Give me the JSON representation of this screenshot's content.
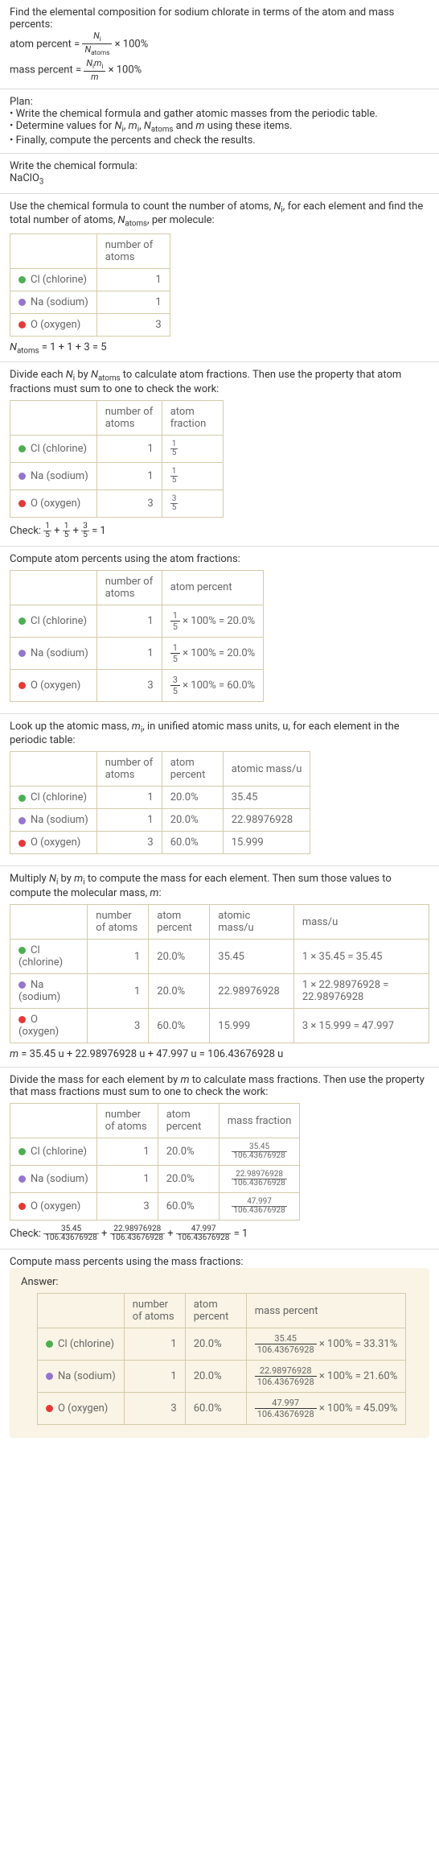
{
  "intro": {
    "line1": "Find the elemental composition for sodium chlorate in terms of the atom and mass percents:",
    "atom_percent_lhs": "atom percent = ",
    "atom_percent_rhs": " × 100%",
    "mass_percent_lhs": "mass percent = ",
    "mass_percent_rhs": " × 100%",
    "frac_ni": "N",
    "frac_ni_sub": "i",
    "frac_natoms": "N",
    "frac_natoms_sub": "atoms",
    "frac_nimi": "N",
    "frac_nimi2_sub": "i",
    "frac_m": "m",
    "frac_m_sub": "i",
    "frac_m_den": "m"
  },
  "plan": {
    "title": "Plan:",
    "b1": "• Write the chemical formula and gather atomic masses from the periodic table.",
    "b2_a": "• Determine values for ",
    "b2_b": " using these items.",
    "var_ni": "N",
    "var_ni_s": "i",
    "var_mi": "m",
    "var_mi_s": "i",
    "var_na": "N",
    "var_na_s": "atoms",
    "var_m": "m",
    "and": " and ",
    "b3": "• Finally, compute the percents and check the results."
  },
  "formula_section": {
    "title": "Write the chemical formula:",
    "formula": "NaClO",
    "formula_sub": "3"
  },
  "count_atoms": {
    "title_a": "Use the chemical formula to count the number of atoms, ",
    "title_ni": "N",
    "title_ni_s": "i",
    "title_b": ", for each element and find the total number of atoms, ",
    "title_na": "N",
    "title_na_s": "atoms",
    "title_c": ", per molecule:",
    "hdr_blank": "",
    "hdr_num": "number of atoms",
    "cl_label": "Cl (chlorine)",
    "cl_n": "1",
    "na_label": "Na (sodium)",
    "na_n": "1",
    "o_label": "O (oxygen)",
    "o_n": "3",
    "total_a": "N",
    "total_a_s": "atoms",
    "total_eq": " = 1 + 1 + 3 = 5"
  },
  "atom_fractions": {
    "title_a": "Divide each ",
    "ni": "N",
    "ni_s": "i",
    "title_b": " by ",
    "na": "N",
    "na_s": "atoms",
    "title_c": " to calculate atom fractions. Then use the property that atom fractions must sum to one to check the work:",
    "hdr_num": "number of atoms",
    "hdr_frac": "atom fraction",
    "cl_label": "Cl (chlorine)",
    "cl_n": "1",
    "cl_fn": "1",
    "cl_fd": "5",
    "na_label": "Na (sodium)",
    "na_n": "1",
    "na_fn": "1",
    "na_fd": "5",
    "o_label": "O (oxygen)",
    "o_n": "3",
    "o_fn": "3",
    "o_fd": "5",
    "check": "Check: ",
    "eq": " = 1"
  },
  "atom_percents": {
    "title": "Compute atom percents using the atom fractions:",
    "hdr_num": "number of atoms",
    "hdr_pct": "atom percent",
    "cl_label": "Cl (chlorine)",
    "cl_n": "1",
    "cl_tail": " × 100% = 20.0%",
    "na_label": "Na (sodium)",
    "na_n": "1",
    "na_tail": " × 100% = 20.0%",
    "o_label": "O (oxygen)",
    "o_n": "3",
    "o_tail": " × 100% = 60.0%"
  },
  "atomic_mass": {
    "title_a": "Look up the atomic mass, ",
    "mi": "m",
    "mi_s": "i",
    "title_b": ", in unified atomic mass units, u, for each element in the periodic table:",
    "hdr_num": "number of atoms",
    "hdr_pct": "atom percent",
    "hdr_mass": "atomic mass/u",
    "cl_label": "Cl (chlorine)",
    "cl_n": "1",
    "cl_p": "20.0%",
    "cl_m": "35.45",
    "na_label": "Na (sodium)",
    "na_n": "1",
    "na_p": "20.0%",
    "na_m": "22.98976928",
    "o_label": "O (oxygen)",
    "o_n": "3",
    "o_p": "60.0%",
    "o_m": "15.999"
  },
  "mol_mass": {
    "title_a": "Multiply ",
    "ni": "N",
    "ni_s": "i",
    "title_b": " by ",
    "mi": "m",
    "mi_s": "i",
    "title_c": " to compute the mass for each element. Then sum those values to compute the molecular mass, ",
    "m": "m",
    "title_d": ":",
    "hdr_num": "number of atoms",
    "hdr_pct": "atom percent",
    "hdr_amass": "atomic mass/u",
    "hdr_mass": "mass/u",
    "cl_label": "Cl (chlorine)",
    "cl_n": "1",
    "cl_p": "20.0%",
    "cl_am": "35.45",
    "cl_m": "1 × 35.45 = 35.45",
    "na_label": "Na (sodium)",
    "na_n": "1",
    "na_p": "20.0%",
    "na_am": "22.98976928",
    "na_m": "1 × 22.98976928 = 22.98976928",
    "o_label": "O (oxygen)",
    "o_n": "3",
    "o_p": "60.0%",
    "o_am": "15.999",
    "o_m": "3 × 15.999 = 47.997",
    "total_a": "m",
    "total_eq": " = 35.45 u + 22.98976928 u + 47.997 u = 106.43676928 u"
  },
  "mass_fractions": {
    "title_a": "Divide the mass for each element by ",
    "m": "m",
    "title_b": " to calculate mass fractions. Then use the property that mass fractions must sum to one to check the work:",
    "hdr_num": "number of atoms",
    "hdr_pct": "atom percent",
    "hdr_mf": "mass fraction",
    "cl_label": "Cl (chlorine)",
    "cl_n": "1",
    "cl_p": "20.0%",
    "cl_fn": "35.45",
    "cl_fd": "106.43676928",
    "na_label": "Na (sodium)",
    "na_n": "1",
    "na_p": "20.0%",
    "na_fn": "22.98976928",
    "na_fd": "106.43676928",
    "o_label": "O (oxygen)",
    "o_n": "3",
    "o_p": "60.0%",
    "o_fn": "47.997",
    "o_fd": "106.43676928",
    "check": "Check: ",
    "eq": " = 1"
  },
  "mass_percents": {
    "title": "Compute mass percents using the mass fractions:",
    "answer": "Answer:",
    "hdr_num": "number of atoms",
    "hdr_pct": "atom percent",
    "hdr_mp": "mass percent",
    "cl_label": "Cl (chlorine)",
    "cl_n": "1",
    "cl_p": "20.0%",
    "cl_fn": "35.45",
    "cl_fd": "106.43676928",
    "cl_tail": " × 100% = 33.31%",
    "na_label": "Na (sodium)",
    "na_n": "1",
    "na_p": "20.0%",
    "na_fn": "22.98976928",
    "na_fd": "106.43676928",
    "na_tail": " × 100% = 21.60%",
    "o_label": "O (oxygen)",
    "o_n": "3",
    "o_p": "60.0%",
    "o_fn": "47.997",
    "o_fd": "106.43676928",
    "o_tail": " × 100% = 45.09%"
  }
}
